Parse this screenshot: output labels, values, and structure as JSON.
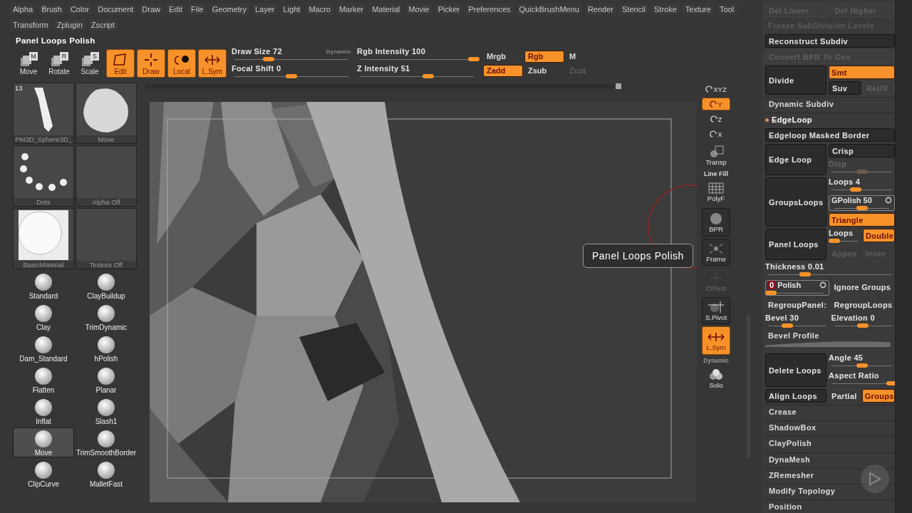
{
  "menu_rows": [
    [
      "Alpha",
      "Brush",
      "Color",
      "Document",
      "Draw",
      "Edit",
      "File",
      "Geometry",
      "Layer",
      "Light",
      "Macro",
      "Marker",
      "Material",
      "Movie",
      "Picker",
      "Preferences",
      "QuickBrushMenu",
      "Render",
      "Stencil",
      "Stroke",
      "Texture",
      "Tool"
    ],
    [
      "Transform",
      "Zplugin",
      "Zscript"
    ]
  ],
  "title": "Panel Loops Polish",
  "toolbar": {
    "tools": [
      {
        "kind": "move",
        "badge": "M",
        "label": "Move",
        "on": false
      },
      {
        "kind": "rotate",
        "badge": "R",
        "label": "Rotate",
        "on": false
      },
      {
        "kind": "scale",
        "badge": "S",
        "label": "Scale",
        "on": false
      },
      {
        "kind": "edit",
        "label": "Edit",
        "on": true
      },
      {
        "kind": "draw",
        "label": "Draw",
        "on": true
      },
      {
        "kind": "local",
        "label": "Local",
        "on": true
      },
      {
        "kind": "lsym",
        "label": "L.Sym",
        "on": true
      }
    ],
    "sliders": [
      {
        "label": "Draw Size 72",
        "note": "Dynamic",
        "level": 0.3
      },
      {
        "label": "Rgb Intensity 100",
        "level": 1
      },
      {
        "label": "Focal Shift 0",
        "level": 0.5
      },
      {
        "label": "Z Intensity 51",
        "level": 0.6
      }
    ],
    "toggles": [
      [
        {
          "label": "Mrgb",
          "on": false,
          "disabled": false
        },
        {
          "label": "Rgb",
          "on": true,
          "disabled": false
        },
        {
          "label": "M",
          "on": false,
          "disabled": false
        }
      ],
      [
        {
          "label": "Zadd",
          "on": true,
          "disabled": false
        },
        {
          "label": "Zsub",
          "on": false,
          "disabled": false
        },
        {
          "label": "Zcut",
          "on": false,
          "disabled": true
        }
      ]
    ]
  },
  "palette": {
    "thumbs": [
      {
        "kind": "tool",
        "label": "PM3D_Sphere3D_",
        "badge": "13"
      },
      {
        "kind": "brush",
        "label": "Move"
      },
      {
        "kind": "stroke",
        "label": "Dots"
      },
      {
        "kind": "alpha",
        "label": "Alpha Off"
      },
      {
        "kind": "material",
        "label": "BasicMaterial"
      },
      {
        "kind": "texture",
        "label": "Texture Off"
      }
    ],
    "brushes": [
      {
        "label": "Standard",
        "selected": false
      },
      {
        "label": "ClayBuildup",
        "selected": false
      },
      {
        "label": "Clay",
        "selected": false
      },
      {
        "label": "TrimDynamic",
        "selected": false
      },
      {
        "label": "Dam_Standard",
        "selected": false
      },
      {
        "label": "hPolish",
        "selected": false
      },
      {
        "label": "Flatten",
        "selected": false
      },
      {
        "label": "Planar",
        "selected": false
      },
      {
        "label": "Inflat",
        "selected": false
      },
      {
        "label": "Slash1",
        "selected": false
      },
      {
        "label": "Move",
        "selected": true
      },
      {
        "label": "TrimSmoothBorder",
        "selected": false
      },
      {
        "label": "ClipCurve",
        "selected": false
      },
      {
        "label": "MalletFast",
        "selected": false
      }
    ]
  },
  "tooltip": "Panel Loops Polish",
  "shelf": [
    {
      "kind": "axis",
      "label": "XYZ",
      "on": false,
      "disabled": false
    },
    {
      "kind": "axis",
      "label": "Y",
      "on": true,
      "disabled": false
    },
    {
      "kind": "axis",
      "label": "Z",
      "on": false,
      "disabled": false
    },
    {
      "kind": "axis",
      "label": "X",
      "on": false,
      "disabled": false
    },
    {
      "kind": "transp",
      "label": "Transp",
      "on": false,
      "disabled": false
    },
    {
      "kind": "polyf",
      "caption": "Line Fill",
      "label": "PolyF",
      "on": false,
      "disabled": false
    },
    {
      "kind": "bpr",
      "label": "BPR",
      "on": false,
      "disabled": false
    },
    {
      "kind": "frame",
      "label": "Frame",
      "on": false,
      "disabled": false
    },
    {
      "kind": "pivot",
      "label": "CPivot",
      "on": false,
      "disabled": true
    },
    {
      "kind": "spivot",
      "label": "S.Pivot",
      "on": false,
      "disabled": false
    },
    {
      "kind": "lsym",
      "label": "L.Sym",
      "on": true,
      "disabled": false
    },
    {
      "kind": "solo",
      "caption": "Dynamic",
      "label": "Solo",
      "on": false,
      "disabled": false
    }
  ],
  "right_panel": [
    {
      "kind": "row",
      "cells": [
        {
          "kind": "button",
          "label": "Del Lower",
          "disabled": true
        },
        {
          "kind": "button",
          "label": "Del Higher",
          "disabled": true
        }
      ]
    },
    {
      "kind": "row",
      "cells": [
        {
          "kind": "text",
          "label": "Freeze SubDivision Levels",
          "disabled": true
        }
      ]
    },
    {
      "kind": "row",
      "cells": [
        {
          "kind": "button",
          "label": "Reconstruct Subdiv",
          "disabled": false
        }
      ]
    },
    {
      "kind": "row",
      "cells": [
        {
          "kind": "button",
          "label": "Convert BPR To Geo",
          "disabled": true
        }
      ]
    },
    {
      "kind": "split",
      "main": {
        "label": "Divide",
        "disabled": false
      },
      "side": [
        {
          "cells": [
            {
              "kind": "toggle",
              "label": "Smt",
              "on": true,
              "disabled": false
            }
          ]
        },
        {
          "cells": [
            {
              "kind": "button",
              "label": "Suv",
              "disabled": false
            },
            {
              "kind": "button",
              "label": "ReUV",
              "disabled": true
            }
          ]
        }
      ]
    },
    {
      "kind": "section",
      "label": "Dynamic Subdiv",
      "expanded": false
    },
    {
      "kind": "section",
      "label": "EdgeLoop",
      "expanded": true
    },
    {
      "kind": "row",
      "cells": [
        {
          "kind": "button",
          "label": "Edgeloop Masked Border",
          "disabled": false
        }
      ]
    },
    {
      "kind": "split",
      "main": {
        "label": "Edge Loop",
        "disabled": false
      },
      "side": [
        {
          "cells": [
            {
              "kind": "button",
              "label": "Crisp",
              "disabled": false
            }
          ]
        },
        {
          "cells": [
            {
              "kind": "slider",
              "label": "Disp",
              "level": 0.5,
              "disabled": true
            }
          ]
        }
      ]
    },
    {
      "kind": "split",
      "main": {
        "label": "GroupsLoops",
        "disabled": false
      },
      "side": [
        {
          "cells": [
            {
              "kind": "slider",
              "label": "Loops 4",
              "level": 0.4,
              "disabled": false
            }
          ]
        },
        {
          "cells": [
            {
              "kind": "ring-slider",
              "label": "GPolish 50",
              "level": 0.5,
              "disabled": false
            }
          ]
        },
        {
          "cells": [
            {
              "kind": "toggle",
              "label": "Triangle",
              "on": true,
              "disabled": false
            }
          ]
        }
      ]
    },
    {
      "kind": "split",
      "main": {
        "label": "Panel Loops",
        "disabled": false
      },
      "side": [
        {
          "cells": [
            {
              "kind": "slider",
              "label": "Loops",
              "level": 0.1,
              "disabled": false
            },
            {
              "kind": "toggle",
              "label": "Double",
              "on": true,
              "disabled": false
            }
          ]
        },
        {
          "cells": [
            {
              "kind": "toggle",
              "label": "Appen",
              "on": false,
              "disabled": true
            },
            {
              "kind": "toggle",
              "label": "Inner",
              "on": false,
              "disabled": true
            }
          ]
        }
      ]
    },
    {
      "kind": "row",
      "cells": [
        {
          "kind": "slider",
          "label": "Thickness 0.01",
          "level": 0.3,
          "disabled": false
        }
      ]
    },
    {
      "kind": "row",
      "cells": [
        {
          "kind": "ring-slider",
          "value": "0",
          "label": "Polish",
          "level": 0,
          "disabled": false
        },
        {
          "kind": "toggle",
          "label": "Ignore Groups",
          "on": false,
          "disabled": false
        }
      ]
    },
    {
      "kind": "row",
      "cells": [
        {
          "kind": "toggle",
          "label": "RegroupPanel:",
          "on": false,
          "disabled": false
        },
        {
          "kind": "toggle",
          "label": "RegroupLoops",
          "on": false,
          "disabled": false
        }
      ]
    },
    {
      "kind": "row",
      "cells": [
        {
          "kind": "slider",
          "label": "Bevel 30",
          "level": 0.33,
          "disabled": false
        },
        {
          "kind": "slider",
          "label": "Elevation 0",
          "level": 0.5,
          "disabled": false
        }
      ]
    },
    {
      "kind": "curve",
      "label": "Bevel Profile"
    },
    {
      "kind": "split",
      "main": {
        "label": "Delete Loops",
        "disabled": false
      },
      "side": [
        {
          "cells": [
            {
              "kind": "slider",
              "label": "Angle 45",
              "level": 0.5,
              "disabled": false
            }
          ]
        },
        {
          "cells": [
            {
              "kind": "slider",
              "label": "Aspect Ratio",
              "level": 1,
              "disabled": false
            }
          ]
        }
      ]
    },
    {
      "kind": "row",
      "cells": [
        {
          "kind": "button",
          "label": "Align Loops",
          "disabled": false
        },
        {
          "kind": "toggle",
          "label": "Partial",
          "on": false,
          "disabled": false
        },
        {
          "kind": "toggle",
          "label": "Groups",
          "on": true,
          "disabled": false
        }
      ]
    },
    {
      "kind": "section",
      "label": "Crease",
      "expanded": false
    },
    {
      "kind": "section",
      "label": "ShadowBox",
      "expanded": false
    },
    {
      "kind": "section",
      "label": "ClayPolish",
      "expanded": false
    },
    {
      "kind": "section",
      "label": "DynaMesh",
      "expanded": false
    },
    {
      "kind": "section",
      "label": "ZRemesher",
      "expanded": false
    },
    {
      "kind": "section",
      "label": "Modify Topology",
      "expanded": false
    },
    {
      "kind": "section",
      "label": "Position",
      "expanded": false
    }
  ]
}
